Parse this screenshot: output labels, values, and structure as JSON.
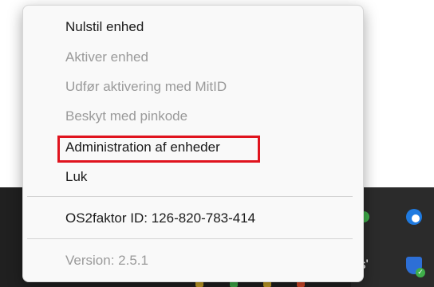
{
  "menu": {
    "items": [
      {
        "label": "Nulstil enhed",
        "enabled": true
      },
      {
        "label": "Aktiver enhed",
        "enabled": false
      },
      {
        "label": "Udfør aktivering med MitID",
        "enabled": false
      },
      {
        "label": "Beskyt med pinkode",
        "enabled": false
      },
      {
        "label": "Administration af enheder",
        "enabled": true,
        "highlighted": true
      },
      {
        "label": "Luk",
        "enabled": true
      }
    ],
    "id_label": "OS2faktor ID: 126-820-783-414",
    "version_label": "Version: 2.5.1"
  },
  "taskbar": {
    "tray_text": "s'",
    "tray_icons": [
      "green-app-icon",
      "edge-icon",
      "defender-shield-icon"
    ]
  },
  "colors": {
    "highlight": "#e0141e",
    "menu_background": "#f9f9f9",
    "disabled_text": "#9a9a9a",
    "taskbar": "#202020"
  }
}
